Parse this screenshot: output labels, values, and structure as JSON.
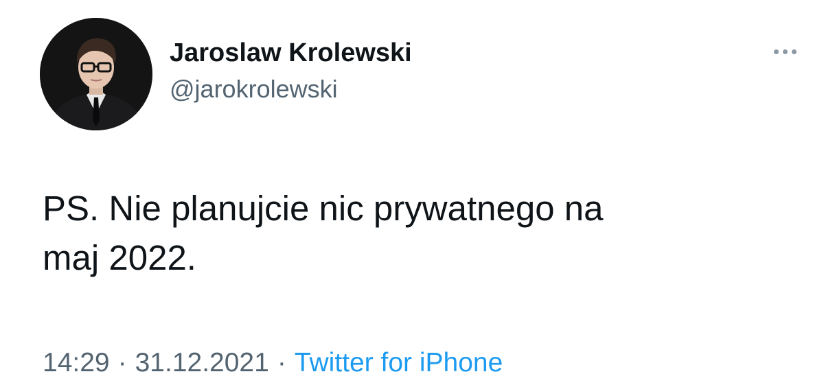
{
  "author": {
    "display_name": "Jaroslaw Krolewski",
    "handle": "@jarokrolewski"
  },
  "more_icon": "more-horizontal-icon",
  "tweet": {
    "text": "PS. Nie planujcie nic prywatnego na\nmaj 2022."
  },
  "meta": {
    "time": "14:29",
    "separator": "·",
    "date": "31.12.2021",
    "source": "Twitter for iPhone"
  },
  "colors": {
    "text": "#0f1419",
    "secondary": "#536471",
    "link": "#1d9bf0"
  }
}
